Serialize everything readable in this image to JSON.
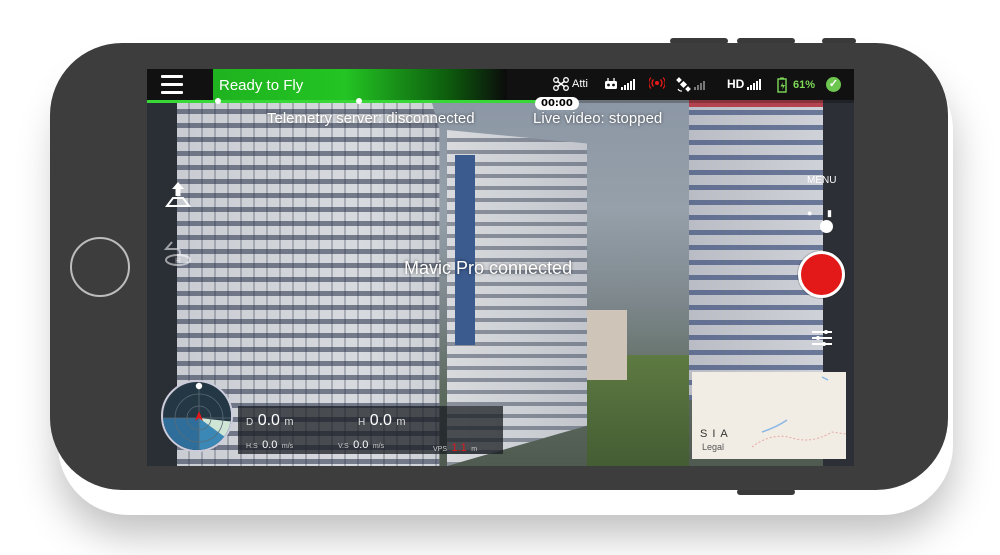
{
  "status": {
    "label": "Ready to Fly",
    "flight_progress_percent": 55
  },
  "topbar": {
    "flight_mode": "Atti",
    "video_quality": "HD",
    "battery": "61%"
  },
  "timer": "00:00",
  "messages": {
    "telemetry": "Telemetry server: disconnected",
    "live_video": "Live video: stopped",
    "connection": "Mavic Pro connected"
  },
  "right_panel": {
    "menu_label": "MENU"
  },
  "telemetry": {
    "distance_label": "D",
    "distance_value": "0.0",
    "distance_unit": "m",
    "height_label": "H",
    "height_value": "0.0",
    "height_unit": "m",
    "hs_label": "H.S",
    "hs_value": "0.0",
    "hs_unit": "m/s",
    "vs_label": "V.S",
    "vs_value": "0.0",
    "vs_unit": "m/s",
    "vps_label": "VPS",
    "vps_value": "1.1",
    "vps_unit": "m"
  },
  "map": {
    "region_label": "SIA",
    "legal": "Legal"
  },
  "colors": {
    "status_green": "#23c423",
    "record_red": "#e31919",
    "battery_green": "#7ed957",
    "warning_red": "#e31919"
  },
  "icons": [
    "menu-icon",
    "drone-icon",
    "remote-icon",
    "signal-warning-icon",
    "satellite-icon",
    "battery-icon",
    "check-icon",
    "takeoff-icon",
    "return-home-icon",
    "photo-icon",
    "video-icon",
    "record-icon",
    "settings-sliders-icon",
    "compass-icon"
  ]
}
